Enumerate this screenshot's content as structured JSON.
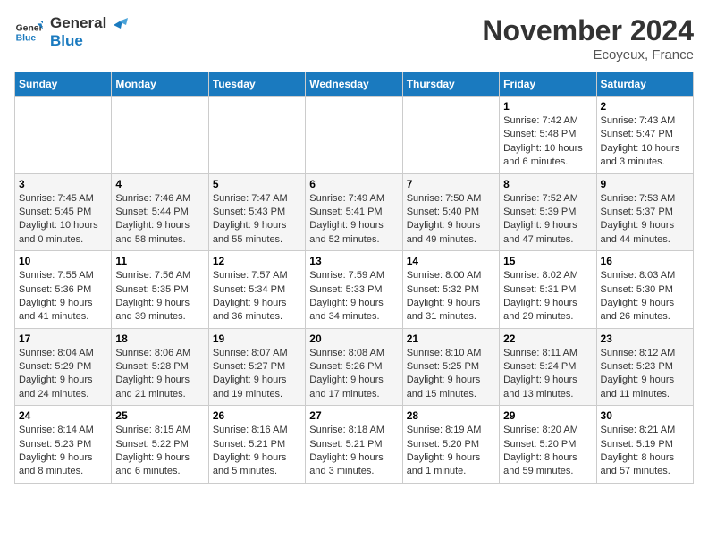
{
  "header": {
    "logo_line1": "General",
    "logo_line2": "Blue",
    "month": "November 2024",
    "location": "Ecoyeux, France"
  },
  "days_of_week": [
    "Sunday",
    "Monday",
    "Tuesday",
    "Wednesday",
    "Thursday",
    "Friday",
    "Saturday"
  ],
  "weeks": [
    [
      {
        "day": "",
        "info": ""
      },
      {
        "day": "",
        "info": ""
      },
      {
        "day": "",
        "info": ""
      },
      {
        "day": "",
        "info": ""
      },
      {
        "day": "",
        "info": ""
      },
      {
        "day": "1",
        "info": "Sunrise: 7:42 AM\nSunset: 5:48 PM\nDaylight: 10 hours and 6 minutes."
      },
      {
        "day": "2",
        "info": "Sunrise: 7:43 AM\nSunset: 5:47 PM\nDaylight: 10 hours and 3 minutes."
      }
    ],
    [
      {
        "day": "3",
        "info": "Sunrise: 7:45 AM\nSunset: 5:45 PM\nDaylight: 10 hours and 0 minutes."
      },
      {
        "day": "4",
        "info": "Sunrise: 7:46 AM\nSunset: 5:44 PM\nDaylight: 9 hours and 58 minutes."
      },
      {
        "day": "5",
        "info": "Sunrise: 7:47 AM\nSunset: 5:43 PM\nDaylight: 9 hours and 55 minutes."
      },
      {
        "day": "6",
        "info": "Sunrise: 7:49 AM\nSunset: 5:41 PM\nDaylight: 9 hours and 52 minutes."
      },
      {
        "day": "7",
        "info": "Sunrise: 7:50 AM\nSunset: 5:40 PM\nDaylight: 9 hours and 49 minutes."
      },
      {
        "day": "8",
        "info": "Sunrise: 7:52 AM\nSunset: 5:39 PM\nDaylight: 9 hours and 47 minutes."
      },
      {
        "day": "9",
        "info": "Sunrise: 7:53 AM\nSunset: 5:37 PM\nDaylight: 9 hours and 44 minutes."
      }
    ],
    [
      {
        "day": "10",
        "info": "Sunrise: 7:55 AM\nSunset: 5:36 PM\nDaylight: 9 hours and 41 minutes."
      },
      {
        "day": "11",
        "info": "Sunrise: 7:56 AM\nSunset: 5:35 PM\nDaylight: 9 hours and 39 minutes."
      },
      {
        "day": "12",
        "info": "Sunrise: 7:57 AM\nSunset: 5:34 PM\nDaylight: 9 hours and 36 minutes."
      },
      {
        "day": "13",
        "info": "Sunrise: 7:59 AM\nSunset: 5:33 PM\nDaylight: 9 hours and 34 minutes."
      },
      {
        "day": "14",
        "info": "Sunrise: 8:00 AM\nSunset: 5:32 PM\nDaylight: 9 hours and 31 minutes."
      },
      {
        "day": "15",
        "info": "Sunrise: 8:02 AM\nSunset: 5:31 PM\nDaylight: 9 hours and 29 minutes."
      },
      {
        "day": "16",
        "info": "Sunrise: 8:03 AM\nSunset: 5:30 PM\nDaylight: 9 hours and 26 minutes."
      }
    ],
    [
      {
        "day": "17",
        "info": "Sunrise: 8:04 AM\nSunset: 5:29 PM\nDaylight: 9 hours and 24 minutes."
      },
      {
        "day": "18",
        "info": "Sunrise: 8:06 AM\nSunset: 5:28 PM\nDaylight: 9 hours and 21 minutes."
      },
      {
        "day": "19",
        "info": "Sunrise: 8:07 AM\nSunset: 5:27 PM\nDaylight: 9 hours and 19 minutes."
      },
      {
        "day": "20",
        "info": "Sunrise: 8:08 AM\nSunset: 5:26 PM\nDaylight: 9 hours and 17 minutes."
      },
      {
        "day": "21",
        "info": "Sunrise: 8:10 AM\nSunset: 5:25 PM\nDaylight: 9 hours and 15 minutes."
      },
      {
        "day": "22",
        "info": "Sunrise: 8:11 AM\nSunset: 5:24 PM\nDaylight: 9 hours and 13 minutes."
      },
      {
        "day": "23",
        "info": "Sunrise: 8:12 AM\nSunset: 5:23 PM\nDaylight: 9 hours and 11 minutes."
      }
    ],
    [
      {
        "day": "24",
        "info": "Sunrise: 8:14 AM\nSunset: 5:23 PM\nDaylight: 9 hours and 8 minutes."
      },
      {
        "day": "25",
        "info": "Sunrise: 8:15 AM\nSunset: 5:22 PM\nDaylight: 9 hours and 6 minutes."
      },
      {
        "day": "26",
        "info": "Sunrise: 8:16 AM\nSunset: 5:21 PM\nDaylight: 9 hours and 5 minutes."
      },
      {
        "day": "27",
        "info": "Sunrise: 8:18 AM\nSunset: 5:21 PM\nDaylight: 9 hours and 3 minutes."
      },
      {
        "day": "28",
        "info": "Sunrise: 8:19 AM\nSunset: 5:20 PM\nDaylight: 9 hours and 1 minute."
      },
      {
        "day": "29",
        "info": "Sunrise: 8:20 AM\nSunset: 5:20 PM\nDaylight: 8 hours and 59 minutes."
      },
      {
        "day": "30",
        "info": "Sunrise: 8:21 AM\nSunset: 5:19 PM\nDaylight: 8 hours and 57 minutes."
      }
    ]
  ]
}
